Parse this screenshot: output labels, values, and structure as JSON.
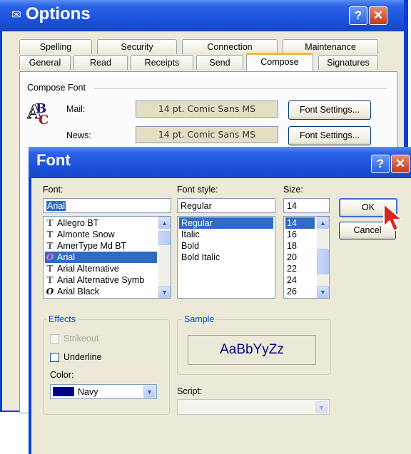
{
  "options": {
    "title": "Options",
    "help_label": "?",
    "close_label": "✕",
    "tabs_row1": [
      "Spelling",
      "Security",
      "Connection",
      "Maintenance"
    ],
    "tabs_row2": [
      "General",
      "Read",
      "Receipts",
      "Send",
      "Compose",
      "Signatures"
    ],
    "active_tab": "Compose",
    "compose_font_label": "Compose Font",
    "mail_label": "Mail:",
    "mail_font": "14 pt. Comic Sans MS",
    "news_label": "News:",
    "news_font": "14 pt. Comic Sans MS",
    "font_settings_label": "Font Settings..."
  },
  "font_dialog": {
    "title": "Font",
    "help_label": "?",
    "close_label": "✕",
    "font_label": "Font:",
    "font_value": "Arial",
    "font_list": [
      {
        "name": "Allegro BT",
        "icon": "TT",
        "selected": false
      },
      {
        "name": "Almonte Snow",
        "icon": "TT",
        "selected": false
      },
      {
        "name": "AmerType Md BT",
        "icon": "TT",
        "selected": false
      },
      {
        "name": "Arial",
        "icon": "O",
        "selected": true
      },
      {
        "name": "Arial Alternative",
        "icon": "TT",
        "selected": false
      },
      {
        "name": "Arial Alternative Symb",
        "icon": "TT",
        "selected": false
      },
      {
        "name": "Arial Black",
        "icon": "O",
        "selected": false
      }
    ],
    "style_label": "Font style:",
    "style_value": "Regular",
    "style_list": [
      {
        "name": "Regular",
        "selected": true
      },
      {
        "name": "Italic",
        "selected": false
      },
      {
        "name": "Bold",
        "selected": false
      },
      {
        "name": "Bold Italic",
        "selected": false
      }
    ],
    "size_label": "Size:",
    "size_value": "14",
    "size_list": [
      {
        "name": "14",
        "selected": true
      },
      {
        "name": "16",
        "selected": false
      },
      {
        "name": "18",
        "selected": false
      },
      {
        "name": "20",
        "selected": false
      },
      {
        "name": "22",
        "selected": false
      },
      {
        "name": "24",
        "selected": false
      },
      {
        "name": "26",
        "selected": false
      }
    ],
    "ok_label": "OK",
    "cancel_label": "Cancel",
    "effects_label": "Effects",
    "strikeout_label": "Strikeout",
    "underline_label": "Underline",
    "color_label": "Color:",
    "color_value": "Navy",
    "color_swatch": "#000080",
    "sample_label": "Sample",
    "sample_text": "AaBbYyZz",
    "script_label": "Script:",
    "script_value": ""
  }
}
